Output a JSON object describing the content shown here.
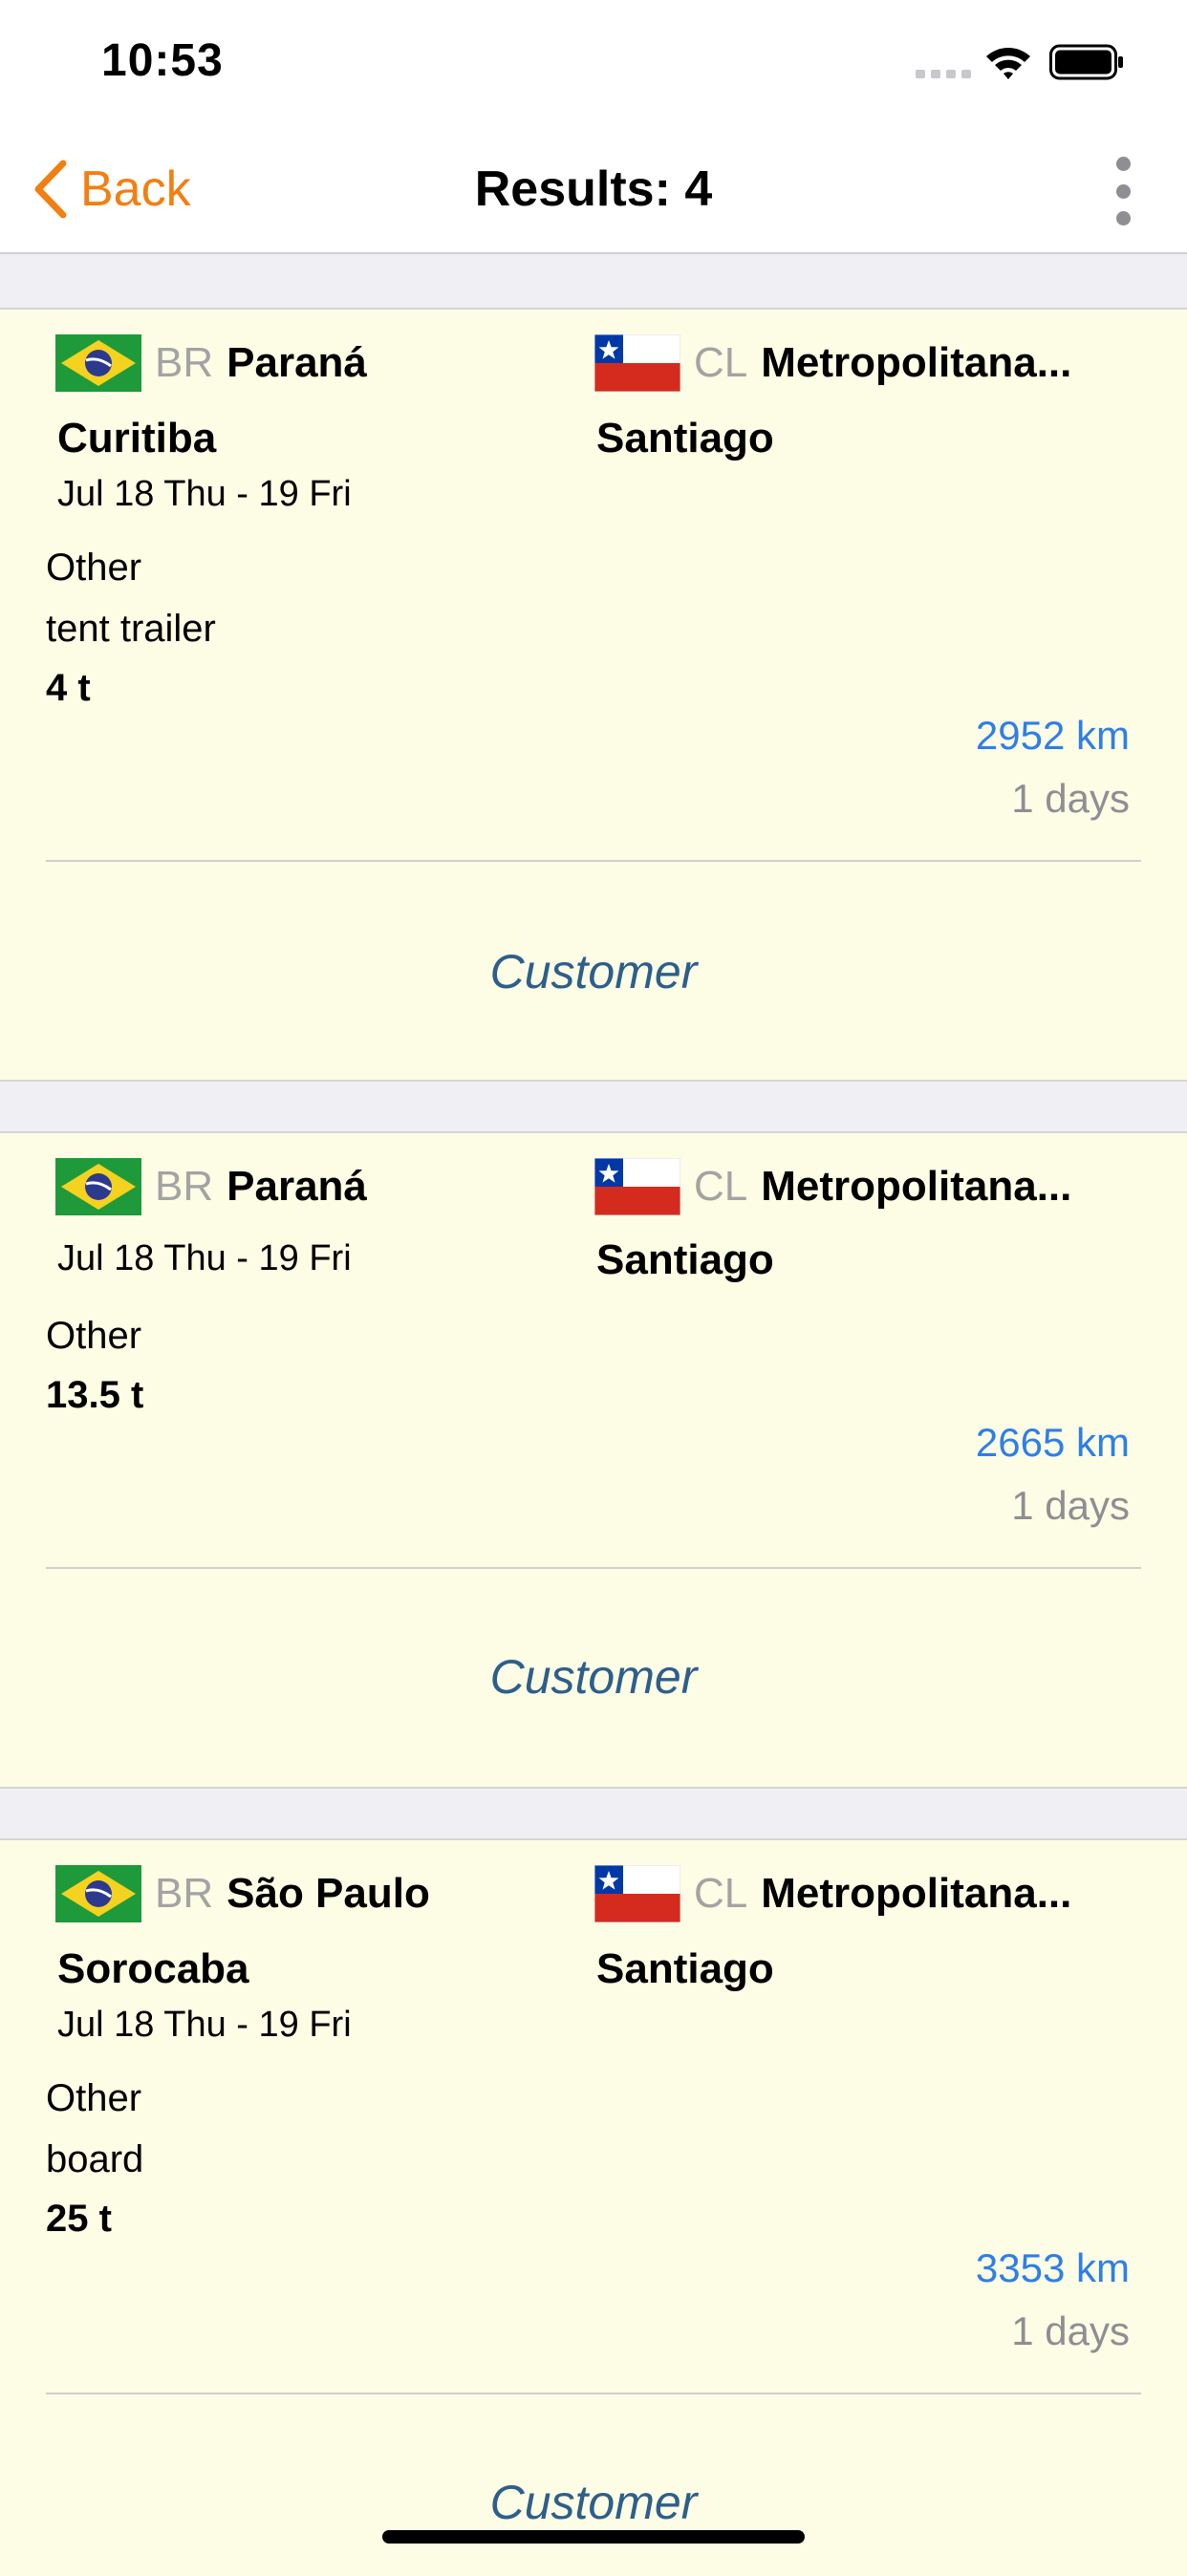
{
  "status": {
    "time": "10:53"
  },
  "nav": {
    "back_label": "Back",
    "title": "Results: 4"
  },
  "results": [
    {
      "origin": {
        "flag": "brazil-flag",
        "code": "BR",
        "region": "Paraná",
        "city": "Curitiba"
      },
      "destination": {
        "flag": "chile-flag",
        "code": "CL",
        "region": "Metropolitana...",
        "city": "Santiago"
      },
      "dates": "Jul 18 Thu - 19 Fri",
      "cargo_type": "Other",
      "body_type": "tent trailer",
      "weight": "4 t",
      "distance": "2952 km",
      "duration": "1 days",
      "contact_label": "Customer"
    },
    {
      "origin": {
        "flag": "brazil-flag",
        "code": "BR",
        "region": "Paraná",
        "city": ""
      },
      "destination": {
        "flag": "chile-flag",
        "code": "CL",
        "region": "Metropolitana...",
        "city": "Santiago"
      },
      "dates": "Jul 18 Thu - 19 Fri",
      "cargo_type": "Other",
      "body_type": "",
      "weight": "13.5 t",
      "distance": "2665 km",
      "duration": "1 days",
      "contact_label": "Customer"
    },
    {
      "origin": {
        "flag": "brazil-flag",
        "code": "BR",
        "region": "São Paulo",
        "city": "Sorocaba"
      },
      "destination": {
        "flag": "chile-flag",
        "code": "CL",
        "region": "Metropolitana...",
        "city": "Santiago"
      },
      "dates": "Jul 18 Thu - 19 Fri",
      "cargo_type": "Other",
      "body_type": "board",
      "weight": "25 t",
      "distance": "3353 km",
      "duration": "1 days",
      "contact_label": "Customer"
    }
  ],
  "colors": {
    "accent": "#f27f12",
    "distance": "#2e7fe8",
    "customer": "#2d5f8a",
    "card_bg": "#fdfde5"
  }
}
